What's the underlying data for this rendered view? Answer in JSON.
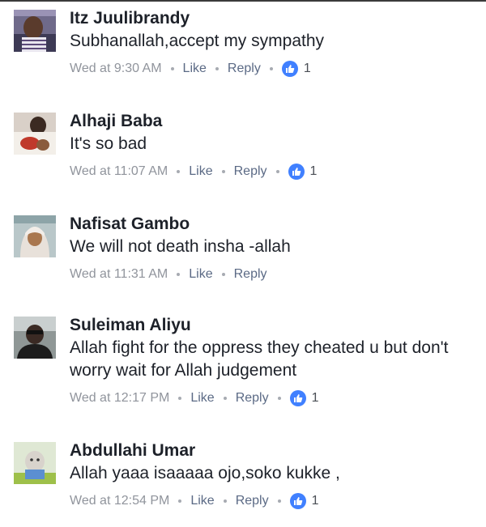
{
  "icons": {
    "like_badge": "thumbs-up-icon",
    "separator": "dot-separator"
  },
  "colors": {
    "name": "#1d2129",
    "text": "#1d2129",
    "timestamp": "#90949c",
    "action": "#5b6a85",
    "like_badge": "#4080ff"
  },
  "comments": [
    {
      "author": "Itz Juulibrandy",
      "text": "Subhanallah,accept my sympathy",
      "timestamp": "Wed at 9:30 AM",
      "like_label": "Like",
      "reply_label": "Reply",
      "reaction_count": "1"
    },
    {
      "author": "Alhaji Baba",
      "text": "It's so bad",
      "timestamp": "Wed at 11:07 AM",
      "like_label": "Like",
      "reply_label": "Reply",
      "reaction_count": "1"
    },
    {
      "author": "Nafisat Gambo",
      "text": "We will not death insha -allah",
      "timestamp": "Wed at 11:31 AM",
      "like_label": "Like",
      "reply_label": "Reply"
    },
    {
      "author": "Suleiman Aliyu",
      "text": "Allah fight for the oppress they cheated u but don't worry wait for Allah judgement",
      "timestamp": "Wed at 12:17 PM",
      "like_label": "Like",
      "reply_label": "Reply",
      "reaction_count": "1"
    },
    {
      "author": "Abdullahi Umar",
      "text": "Allah yaaa isaaaaa ojo,soko kukke ,",
      "timestamp": "Wed at 12:54 PM",
      "like_label": "Like",
      "reply_label": "Reply",
      "reaction_count": "1"
    }
  ]
}
